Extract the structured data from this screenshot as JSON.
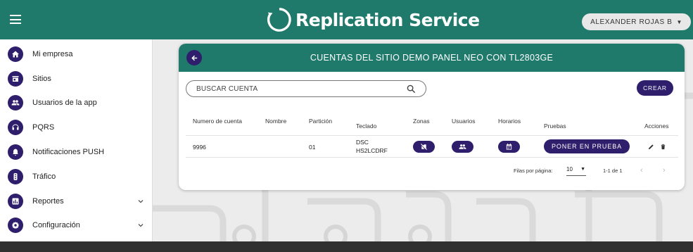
{
  "header": {
    "brand": "Replication Service",
    "user_label": "ALEXANDER ROJAS B"
  },
  "sidebar": {
    "items": [
      {
        "label": "Mi empresa",
        "icon": "home-icon"
      },
      {
        "label": "Sitios",
        "icon": "store-icon"
      },
      {
        "label": "Usuarios de la app",
        "icon": "people-icon"
      },
      {
        "label": "PQRS",
        "icon": "headset-icon"
      },
      {
        "label": "Notificaciones PUSH",
        "icon": "bell-icon"
      },
      {
        "label": "Tráfico",
        "icon": "traffic-icon"
      },
      {
        "label": "Reportes",
        "icon": "chart-icon",
        "expandable": true
      },
      {
        "label": "Configuración",
        "icon": "gear-icon",
        "expandable": true
      }
    ]
  },
  "card": {
    "title": "CUENTAS DEL SITIO DEMO PANEL NEO CON TL2803GE",
    "search_placeholder": "BUSCAR CUENTA",
    "create_label": "CREAR",
    "columns": [
      "Numero de cuenta",
      "Nombre",
      "Partición",
      "Teclado",
      "Zonas",
      "Usuarios",
      "Horarios",
      "Pruebas",
      "Acciones"
    ],
    "rows": [
      {
        "account": "9996",
        "name": "",
        "partition": "01",
        "keypad_line1": "DSC",
        "keypad_line2": "HS2LCDRF",
        "test_label": "PONER EN PRUEBA"
      }
    ],
    "footer": {
      "rows_per_page_label": "Filas por página:",
      "rows_per_page_value": "10",
      "range": "1-1 de 1"
    }
  },
  "colors": {
    "teal": "#1f7a6c",
    "purple": "#2e1e6b"
  }
}
